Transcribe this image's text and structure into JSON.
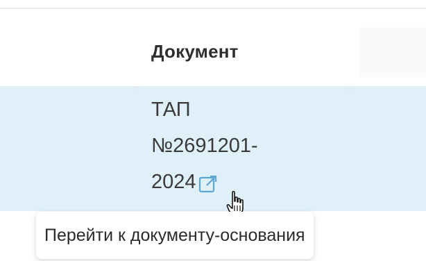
{
  "table": {
    "column_header": "Документ",
    "row": {
      "document_lines": [
        "ТАП",
        "№2691201-",
        "2024"
      ],
      "link_icon": "external-link-icon",
      "selected": true,
      "row_color": "#dff0f8"
    }
  },
  "tooltip": {
    "text": "Перейти к документу-основания"
  },
  "cursor": {
    "type": "hand-pointer-icon"
  },
  "colors": {
    "row_highlight": "#dff0f8",
    "link_icon": "#5ea6d6"
  }
}
